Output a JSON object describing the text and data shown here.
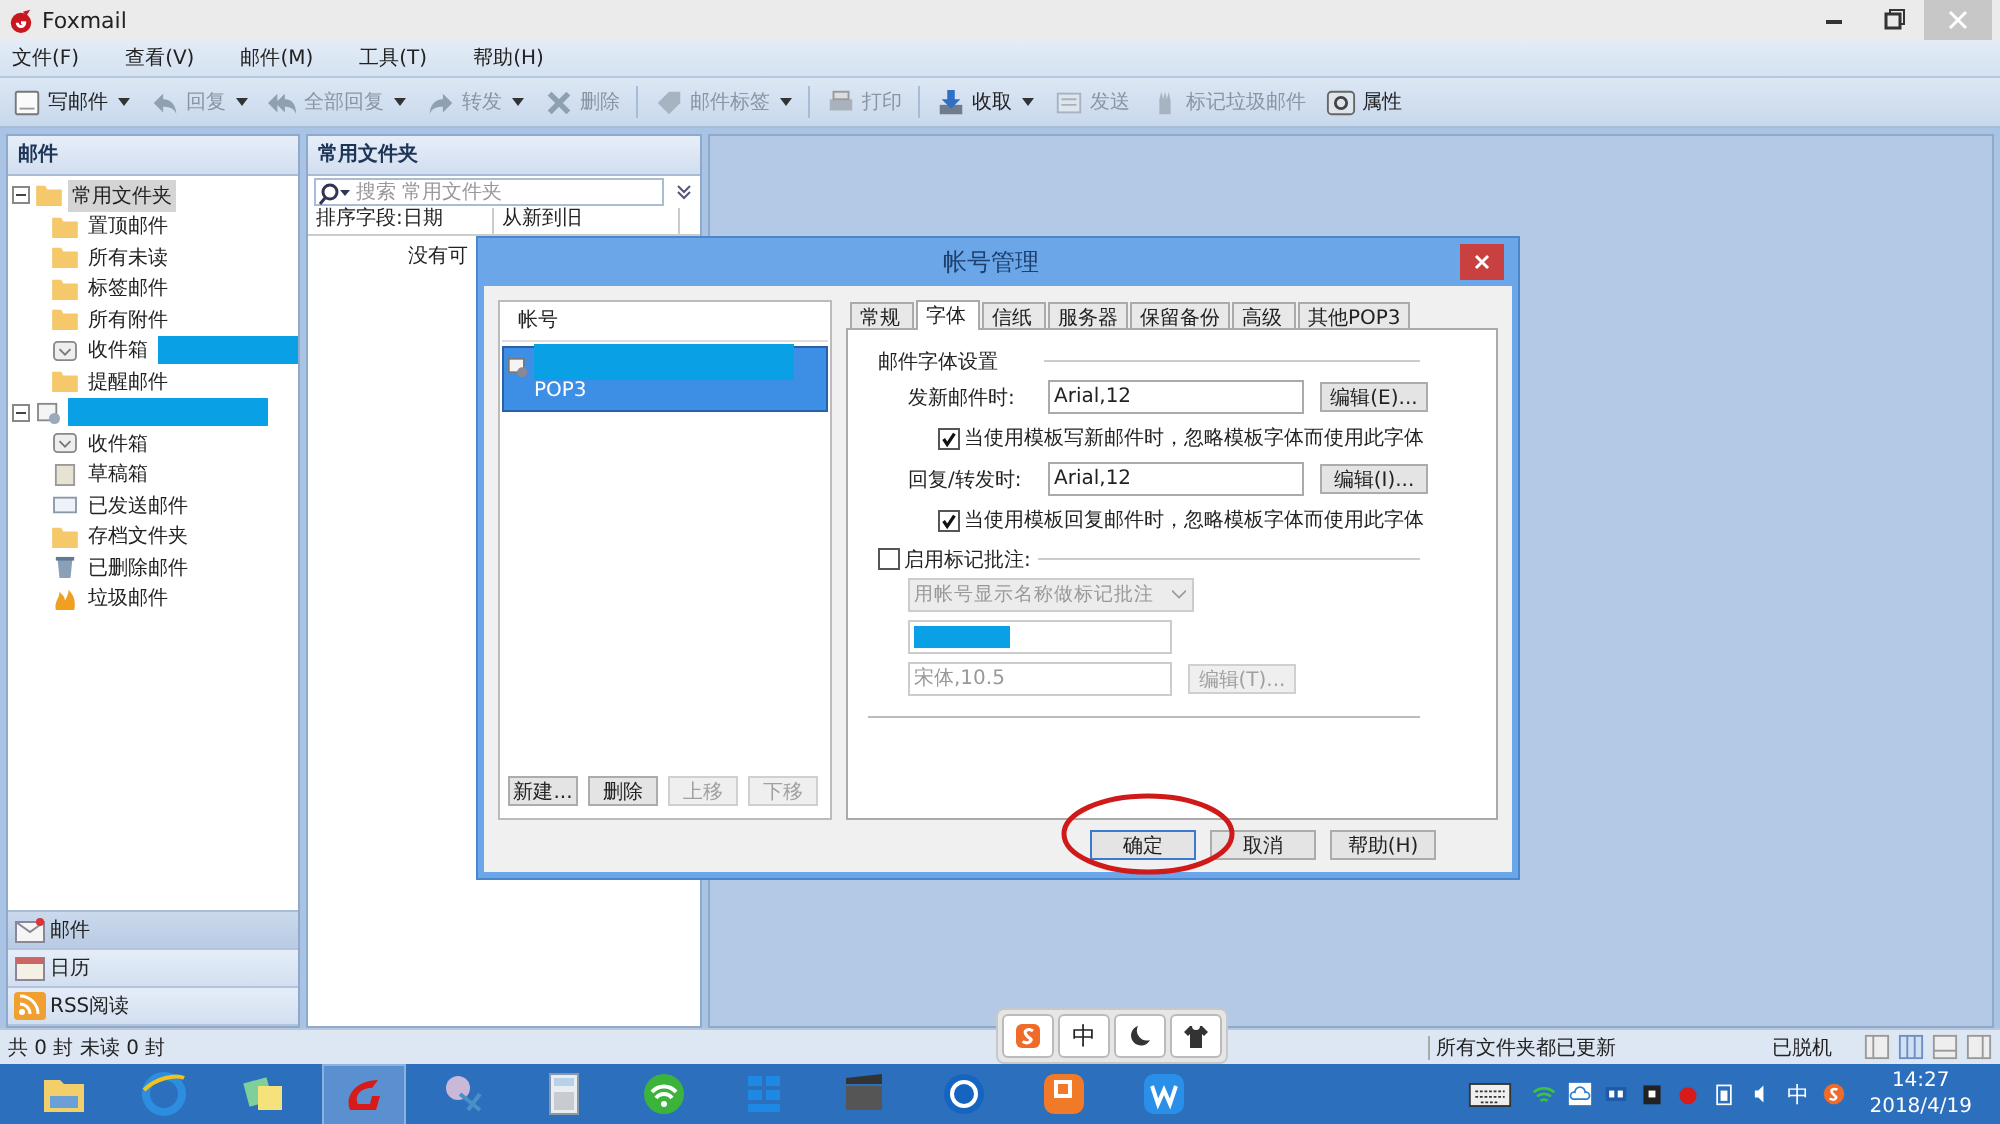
{
  "window": {
    "title": "Foxmail"
  },
  "menu": [
    "文件(F)",
    "查看(V)",
    "邮件(M)",
    "工具(T)",
    "帮助(H)"
  ],
  "toolbar": {
    "groups": [
      [
        {
          "kind": "compose",
          "label": "写邮件",
          "dropdown": true,
          "disabled": false
        },
        {
          "kind": "reply",
          "label": "回复",
          "dropdown": true,
          "disabled": true
        },
        {
          "kind": "replyall",
          "label": "全部回复",
          "dropdown": true,
          "disabled": true
        },
        {
          "kind": "forward",
          "label": "转发",
          "dropdown": true,
          "disabled": true
        },
        {
          "kind": "delete",
          "label": "删除",
          "dropdown": false,
          "disabled": true
        }
      ],
      [
        {
          "kind": "tag",
          "label": "邮件标签",
          "dropdown": true,
          "disabled": true
        }
      ],
      [
        {
          "kind": "print",
          "label": "打印",
          "dropdown": false,
          "disabled": true
        }
      ],
      [
        {
          "kind": "receive",
          "label": "收取",
          "dropdown": true,
          "disabled": false
        },
        {
          "kind": "send",
          "label": "发送",
          "dropdown": false,
          "disabled": true
        },
        {
          "kind": "junk",
          "label": "标记垃圾邮件",
          "dropdown": false,
          "disabled": true
        },
        {
          "kind": "properties",
          "label": "属性",
          "dropdown": false,
          "disabled": false
        }
      ]
    ]
  },
  "folders_panel": {
    "title": "邮件",
    "folders": [
      {
        "kind": "folder",
        "label": "常用文件夹",
        "expanded": true,
        "selected": true,
        "redacted": false,
        "children": [
          {
            "kind": "folder",
            "label": "置顶邮件",
            "selected": false,
            "redacted": false
          },
          {
            "kind": "folder",
            "label": "所有未读",
            "selected": false,
            "redacted": false
          },
          {
            "kind": "folder",
            "label": "标签邮件",
            "selected": false,
            "redacted": false
          },
          {
            "kind": "folder",
            "label": "所有附件",
            "selected": false,
            "redacted": false
          },
          {
            "kind": "inbox",
            "label": "收件箱",
            "selected": false,
            "redacted": true
          },
          {
            "kind": "folder",
            "label": "提醒邮件",
            "selected": false,
            "redacted": false
          }
        ]
      },
      {
        "kind": "account",
        "expanded": true,
        "selected": false,
        "redacted": true,
        "children": [
          {
            "kind": "inbox",
            "label": "收件箱",
            "selected": false,
            "redacted": false
          },
          {
            "kind": "drafts",
            "label": "草稿箱",
            "selected": false,
            "redacted": false
          },
          {
            "kind": "sent",
            "label": "已发送邮件",
            "selected": false,
            "redacted": false
          },
          {
            "kind": "folder",
            "label": "存档文件夹",
            "selected": false,
            "redacted": false
          },
          {
            "kind": "trash",
            "label": "已删除邮件",
            "selected": false,
            "redacted": false
          },
          {
            "kind": "junk",
            "label": "垃圾邮件",
            "selected": false,
            "redacted": false
          }
        ]
      }
    ],
    "nav": [
      {
        "kind": "mail",
        "label": "邮件",
        "selected": true
      },
      {
        "kind": "calendar",
        "label": "日历",
        "selected": false
      },
      {
        "kind": "rss",
        "label": "RSS阅读",
        "selected": false
      }
    ]
  },
  "list_panel": {
    "title": "常用文件夹",
    "search": {
      "placeholder": "搜索 常用文件夹"
    },
    "columns": [
      "排序字段:日期",
      "从新到旧"
    ],
    "empty_message": "没有可"
  },
  "dialog": {
    "title": "帐号管理",
    "accounts": {
      "header": "帐号",
      "items": [
        {
          "type": "POP3",
          "selected": true
        }
      ]
    },
    "account_buttons": [
      {
        "label": "新建...",
        "disabled": false
      },
      {
        "label": "删除",
        "disabled": false
      },
      {
        "label": "上移",
        "disabled": true
      },
      {
        "label": "下移",
        "disabled": true
      }
    ],
    "tabs": [
      {
        "label": "常规",
        "selected": false
      },
      {
        "label": "字体",
        "selected": true
      },
      {
        "label": "信纸",
        "selected": false
      },
      {
        "label": "服务器",
        "selected": false
      },
      {
        "label": "保留备份",
        "selected": false
      },
      {
        "label": "高级",
        "selected": false
      },
      {
        "label": "其他POP3",
        "selected": false
      }
    ],
    "font_settings": {
      "title": "邮件字体设置",
      "rows": [
        {
          "label": "发新邮件时:",
          "value": "Arial,12",
          "button": "编辑(E)...",
          "option": {
            "label": "当使用模板写新邮件时，忽略模板字体而使用此字体",
            "checked": true
          }
        },
        {
          "label": "回复/转发时:",
          "value": "Arial,12",
          "button": "编辑(I)...",
          "option": {
            "label": "当使用模板回复邮件时，忽略模板字体而使用此字体",
            "checked": true
          }
        }
      ]
    },
    "annotation_settings": {
      "label": "启用标记批注:",
      "checked": false,
      "mode": {
        "value": "用帐号显示名称做标记批注",
        "disabled": true
      },
      "font": {
        "value": "宋体,10.5",
        "disabled": true
      },
      "button": {
        "label": "编辑(T)...",
        "disabled": true
      }
    },
    "buttons": [
      {
        "label": "确定",
        "default": true
      },
      {
        "label": "取消",
        "default": false
      },
      {
        "label": "帮助(H)",
        "default": false
      }
    ]
  },
  "status_bar": {
    "count": "共 0 封 未读 0 封",
    "message": "所有文件夹都已更新",
    "state": "已脱机"
  },
  "ime_bar": {
    "mode": "中"
  },
  "taskbar": {
    "apps": [
      {
        "kind": "explorer",
        "selected": false
      },
      {
        "kind": "browser",
        "selected": false
      },
      {
        "kind": "notes",
        "selected": false
      },
      {
        "kind": "mail",
        "selected": true
      },
      {
        "kind": "snip",
        "selected": false
      },
      {
        "kind": "calculator",
        "selected": false
      },
      {
        "kind": "wifi",
        "selected": false
      },
      {
        "kind": "tiles",
        "selected": false
      },
      {
        "kind": "video",
        "selected": false
      },
      {
        "kind": "circle",
        "selected": false
      },
      {
        "kind": "orange",
        "selected": false
      },
      {
        "kind": "blue",
        "selected": false
      }
    ],
    "input_mode": "中",
    "time": "14:27",
    "date": "2018/4/19"
  }
}
